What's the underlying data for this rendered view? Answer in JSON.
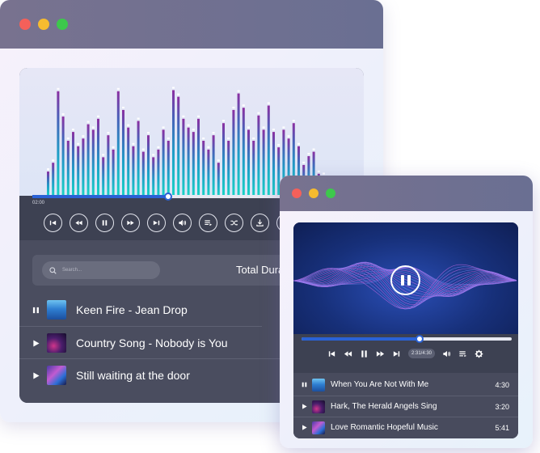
{
  "back_window": {
    "progress": 0.41,
    "elapsed": "02:00",
    "search_placeholder": "Search...",
    "total_label": "Total Duration",
    "controls": [
      "skip-previous-icon",
      "rewind-icon",
      "pause-icon",
      "fast-forward-icon",
      "skip-next-icon",
      "volume-icon",
      "playlist-icon",
      "shuffle-icon",
      "download-icon",
      "settings-icon"
    ],
    "songs": [
      {
        "title": "Keen Fire - Jean Drop",
        "state": "playing"
      },
      {
        "title": "Country Song - Nobody is You",
        "state": "paused"
      },
      {
        "title": "Still waiting at the door",
        "state": "paused"
      }
    ],
    "visualizer_levels": [
      0.22,
      0.3,
      0.95,
      0.72,
      0.5,
      0.58,
      0.45,
      0.52,
      0.65,
      0.6,
      0.7,
      0.35,
      0.55,
      0.42,
      0.95,
      0.78,
      0.62,
      0.45,
      0.68,
      0.4,
      0.55,
      0.35,
      0.42,
      0.6,
      0.5,
      0.96,
      0.9,
      0.7,
      0.62,
      0.58,
      0.7,
      0.5,
      0.42,
      0.55,
      0.3,
      0.66,
      0.5,
      0.78,
      0.93,
      0.8,
      0.6,
      0.5,
      0.73,
      0.6,
      0.82,
      0.58,
      0.44,
      0.6,
      0.52,
      0.66,
      0.45,
      0.28,
      0.36,
      0.4,
      0.2,
      0.18,
      0.12,
      0.1
    ]
  },
  "front_window": {
    "progress": 0.56,
    "time": "2:31/4:30",
    "songs": [
      {
        "title": "When You Are Not With Me",
        "duration": "4:30",
        "state": "playing"
      },
      {
        "title": "Hark, The Herald Angels Sing",
        "duration": "3:20",
        "state": "paused"
      },
      {
        "title": "Love Romantic Hopeful Music",
        "duration": "5:41",
        "state": "paused"
      }
    ]
  },
  "colors": {
    "accent": "#2a62d6",
    "panel": "#3d4152",
    "titlebar": "#716f90",
    "bar_top": "#8c2fa1",
    "bar_bottom": "#19d3c5"
  }
}
